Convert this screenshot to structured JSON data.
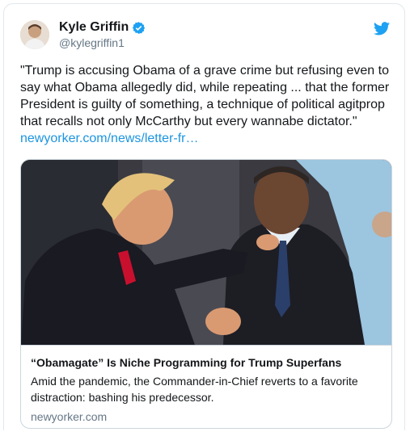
{
  "user": {
    "name": "Kyle Griffin",
    "handle": "@kylegriffin1"
  },
  "tweet": {
    "text": "\"Trump is accusing Obama of a grave crime but refusing even to say what Obama allegedly did, while repeating ... that the former President is guilty of something, a technique of political agitprop that recalls not only McCarthy but every wannabe dictator.\"",
    "link": "newyorker.com/news/letter-fr…"
  },
  "card": {
    "title": "“Obamagate” Is Niche Programming for Trump Superfans",
    "description": "Amid the pandemic, the Commander-in-Chief reverts to a favorite distraction: bashing his predecessor.",
    "domain": "newyorker.com"
  },
  "colors": {
    "accent": "#1b95e0",
    "verified": "#1da1f2",
    "secondary_text": "#657786"
  },
  "icons": {
    "verified": "verified-badge-icon",
    "brand": "twitter-bird-icon"
  }
}
